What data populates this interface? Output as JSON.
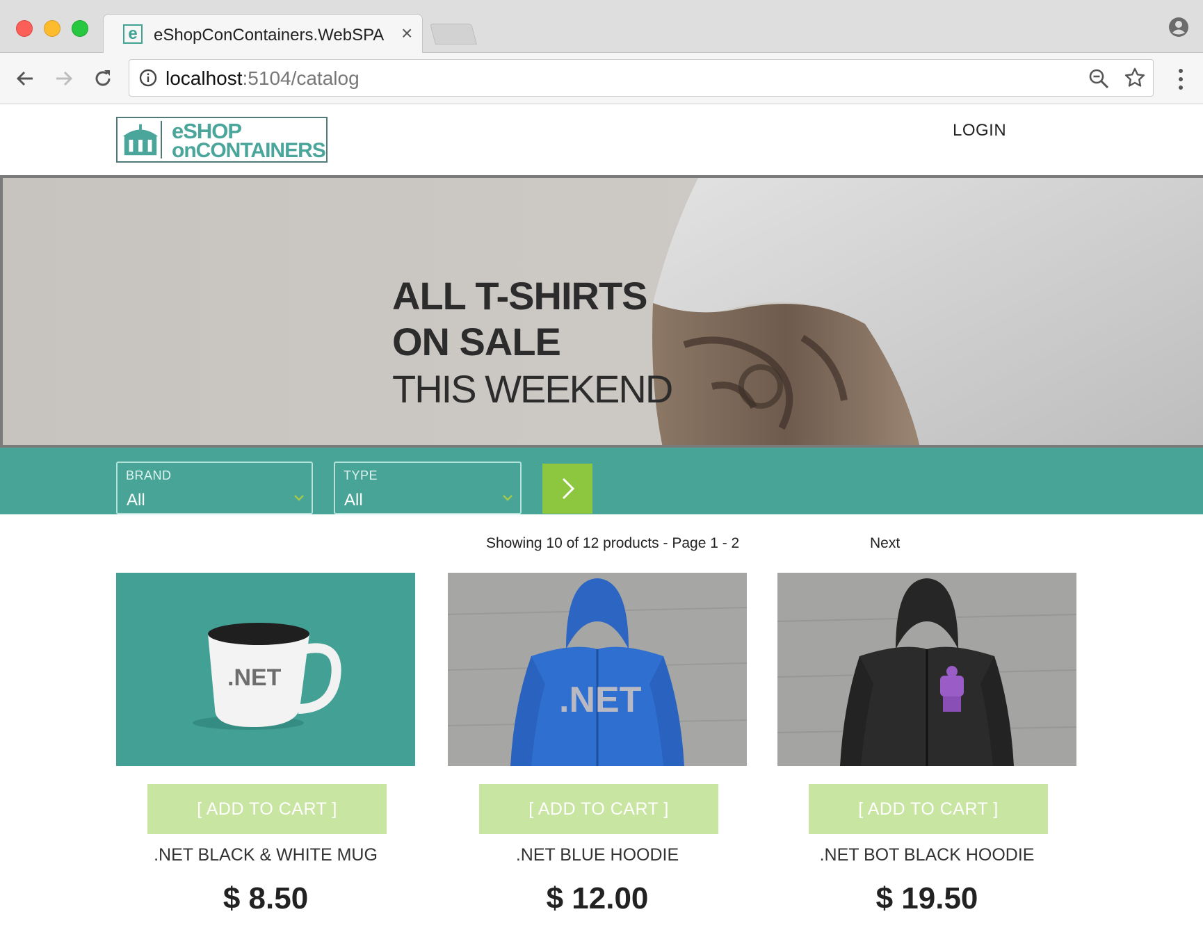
{
  "browser": {
    "tab_title": "eShopConContainers.WebSPA",
    "tab_favicon_letter": "e",
    "tab_close": "×",
    "url_host": "localhost",
    "url_path": ":5104/catalog"
  },
  "header": {
    "logo_line1": "eSHOP",
    "logo_line2": "onCONTAINERS",
    "login": "LOGIN"
  },
  "hero": {
    "line1": "ALL T-SHIRTS",
    "line2": "ON SALE",
    "line3": "THIS WEEKEND"
  },
  "filters": {
    "brand": {
      "label": "BRAND",
      "value": "All"
    },
    "type": {
      "label": "TYPE",
      "value": "All"
    }
  },
  "pager": {
    "status": "Showing 10 of 12 products - Page 1 - 2",
    "next": "Next"
  },
  "products": [
    {
      "add_label": "[ ADD TO CART ]",
      "name": ".NET BLACK & WHITE MUG",
      "price": "$ 8.50",
      "image_text": ".NET"
    },
    {
      "add_label": "[ ADD TO CART ]",
      "name": ".NET BLUE HOODIE",
      "price": "$ 12.00",
      "image_text": ".NET"
    },
    {
      "add_label": "[ ADD TO CART ]",
      "name": ".NET BOT BLACK HOODIE",
      "price": "$ 19.50"
    }
  ],
  "colors": {
    "brand_teal": "#48a497",
    "apply_green": "#8dc63f",
    "add_to_cart_bg": "#c9e5a2"
  }
}
